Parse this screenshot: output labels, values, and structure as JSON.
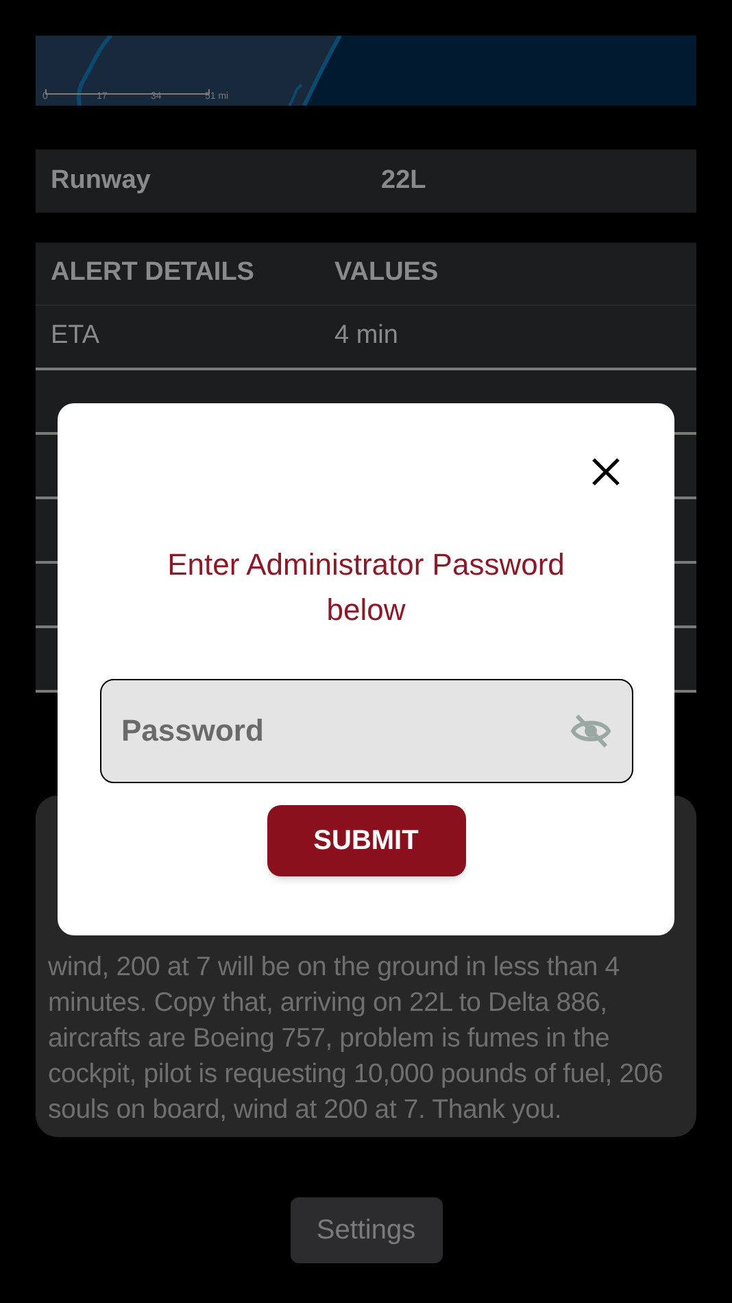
{
  "map": {
    "scale_labels": [
      "0",
      "17",
      "34",
      "51 mi"
    ]
  },
  "runway": {
    "label": "Runway",
    "value": "22L"
  },
  "alert_table": {
    "columns": [
      "ALERT DETAILS",
      "VALUES"
    ],
    "rows": [
      {
        "detail": "ETA",
        "value": "4 min"
      },
      {},
      {},
      {},
      {},
      {}
    ]
  },
  "transcript": {
    "text": "wind, 200 at 7 will be on the ground in less than 4 minutes. Copy that, arriving on 22L to Delta 886, aircrafts are Boeing 757, problem is fumes in the cockpit, pilot is requesting 10,000 pounds of fuel, 206 souls on board, wind at 200 at 7. Thank you."
  },
  "settings_button": {
    "label": "Settings"
  },
  "dialog": {
    "message": "Enter Administrator Password below",
    "password_field": {
      "placeholder": "Password"
    },
    "submit_button": {
      "label": "SUBMIT"
    }
  }
}
